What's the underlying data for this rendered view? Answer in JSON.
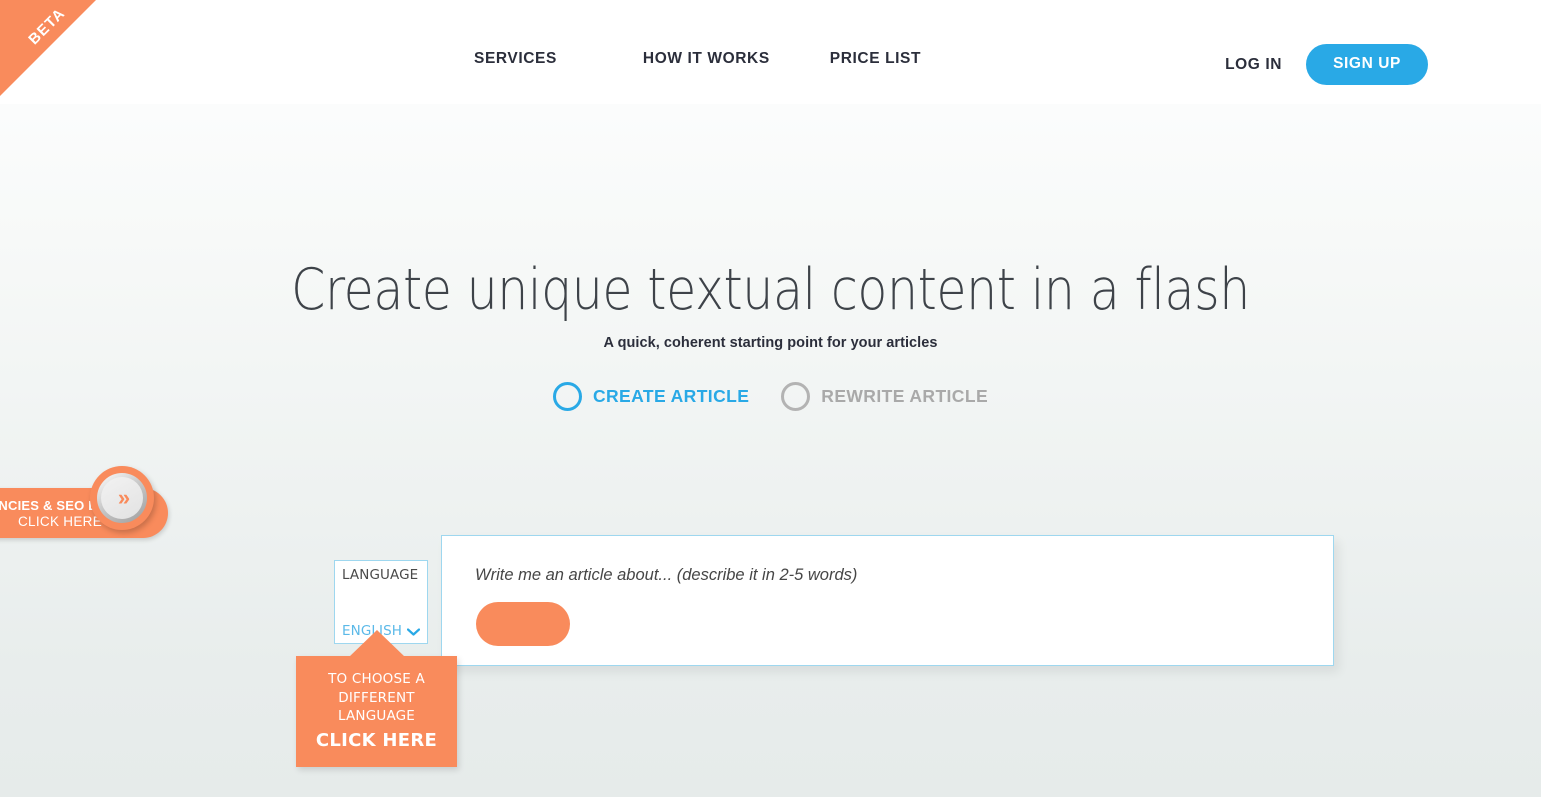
{
  "header": {
    "beta_badge": "BETA",
    "nav": [
      {
        "label": "SERVICES",
        "name": "services"
      },
      {
        "label": "HOW IT WORKS",
        "name": "how-it-works"
      },
      {
        "label": "PRICE LIST",
        "name": "price-list"
      }
    ],
    "login_label": "LOG IN",
    "signup_label": "SIGN UP"
  },
  "hero": {
    "title": "Create unique textual content in a flash",
    "subtitle": "A quick, coherent starting point for your articles"
  },
  "modes": [
    {
      "label": "CREATE ARTICLE",
      "selected": true
    },
    {
      "label": "REWRITE ARTICLE",
      "selected": false
    }
  ],
  "side_badge": {
    "line1": "AGENCIES & SEO EXPERTS",
    "line2": "CLICK HERE",
    "icon": "double-chevron-right-icon",
    "chevron_glyph": "»"
  },
  "language_selector": {
    "label": "LANGUAGE",
    "value": "ENGLISH",
    "chevron_glyph": "⌄",
    "icon": "chevron-down-icon"
  },
  "tooltip": {
    "line1": "TO CHOOSE A",
    "line2": "DIFFERENT LANGUAGE",
    "cta": "CLICK HERE"
  },
  "article_input": {
    "placeholder": "Write me an article about... (describe it in 2-5 words)",
    "value": "",
    "submit_label": ""
  },
  "colors": {
    "accent_orange": "#f98b5c",
    "accent_blue": "#29a9e6",
    "border_blue": "#9ed7ef",
    "text_dark": "#2b2e3b",
    "text_muted": "#a9a9a9"
  }
}
